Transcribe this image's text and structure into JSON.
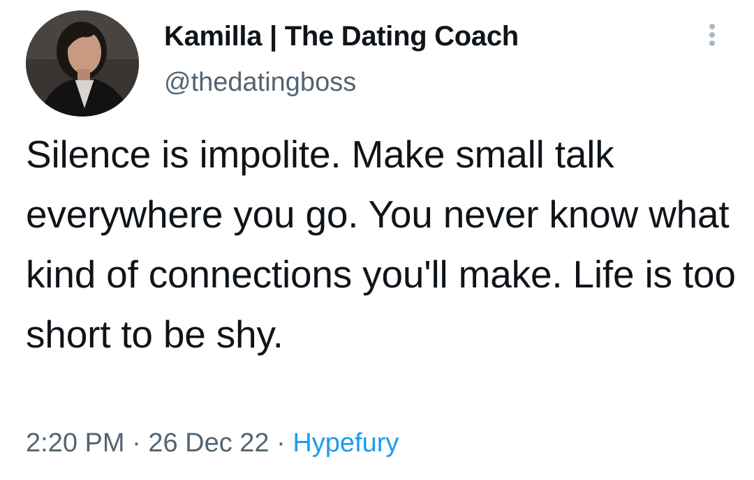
{
  "author": {
    "display_name": "Kamilla | The Dating Coach",
    "handle": "@thedatingboss",
    "avatar_icon": "profile-photo"
  },
  "tweet": {
    "text": "Silence is impolite. Make small talk everywhere you go. You never know what kind of connections you'll make. Life is too short to be shy."
  },
  "meta": {
    "time": "2:20 PM",
    "separator_1": " · ",
    "date": "26 Dec 22",
    "separator_2": " · ",
    "source": "Hypefury"
  },
  "icons": {
    "more": "more-vertical-icon"
  },
  "colors": {
    "text": "#0f1419",
    "secondary": "#536471",
    "link": "#1d9bf0"
  }
}
